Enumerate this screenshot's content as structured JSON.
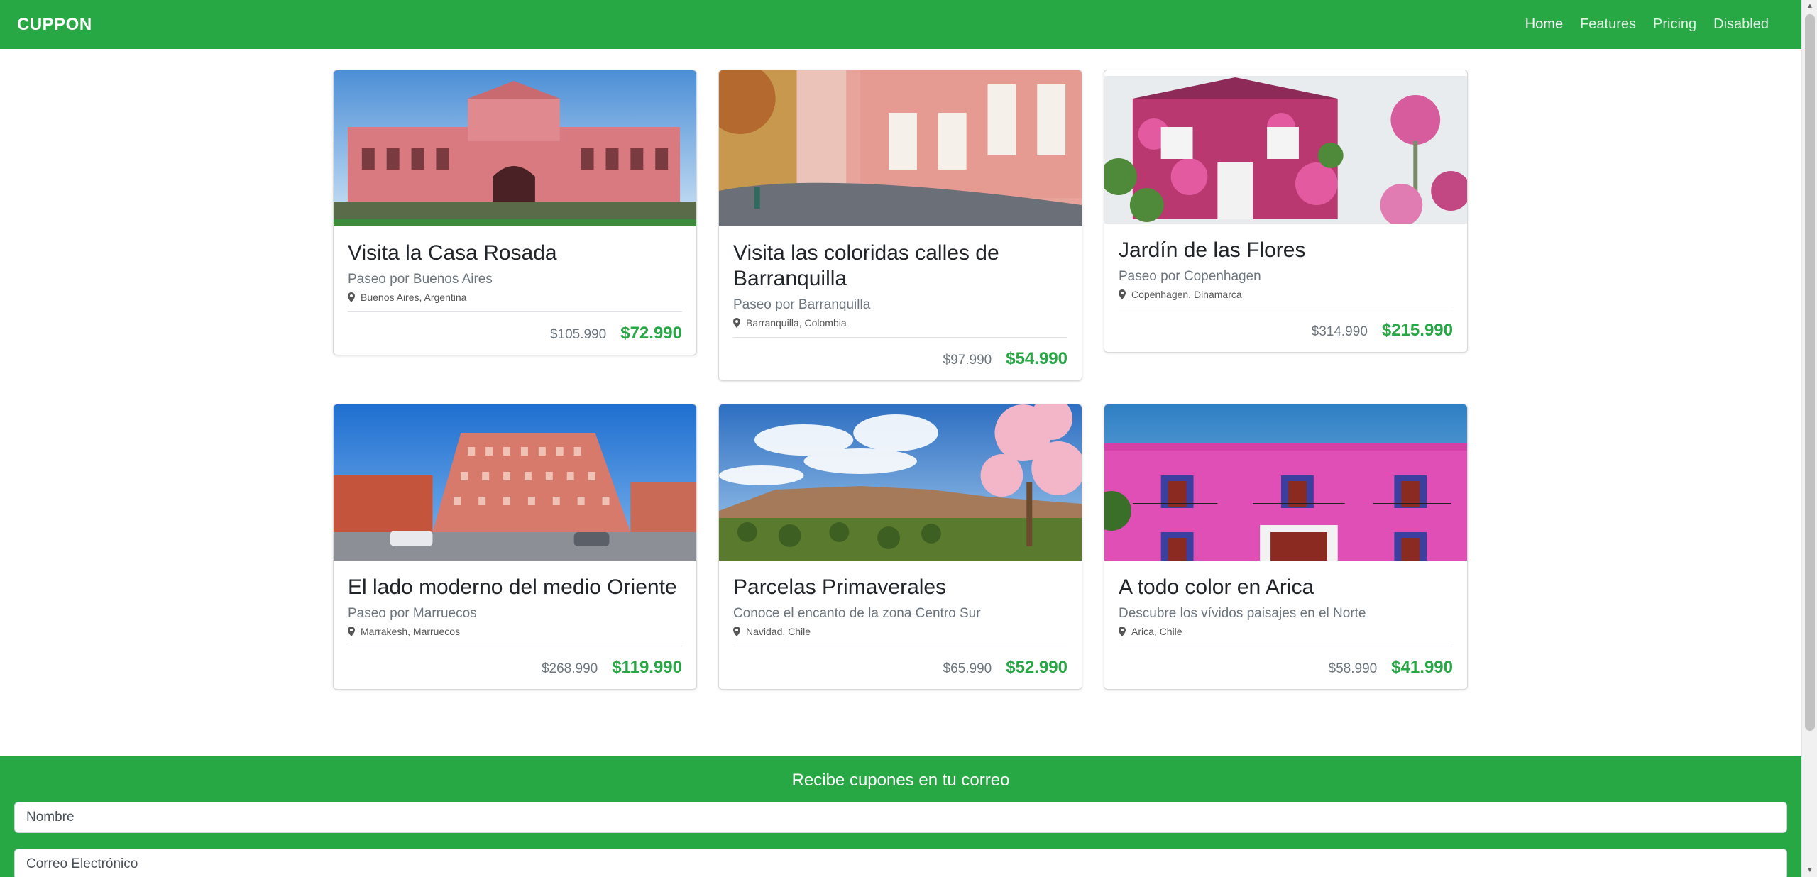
{
  "nav": {
    "brand": "CUPPON",
    "links": [
      "Home",
      "Features",
      "Pricing",
      "Disabled"
    ]
  },
  "cards": [
    {
      "title": "Visita la Casa Rosada",
      "subtitle": "Paseo por Buenos Aires",
      "location": "Buenos Aires, Argentina",
      "old_price": "$105.990",
      "price": "$72.990"
    },
    {
      "title": "Visita las coloridas calles de Barranquilla",
      "subtitle": "Paseo por Barranquilla",
      "location": "Barranquilla, Colombia",
      "old_price": "$97.990",
      "price": "$54.990"
    },
    {
      "title": "Jardín de las Flores",
      "subtitle": "Paseo por Copenhagen",
      "location": "Copenhagen, Dinamarca",
      "old_price": "$314.990",
      "price": "$215.990"
    },
    {
      "title": "El lado moderno del medio Oriente",
      "subtitle": "Paseo por Marruecos",
      "location": "Marrakesh, Marruecos",
      "old_price": "$268.990",
      "price": "$119.990"
    },
    {
      "title": "Parcelas Primaverales",
      "subtitle": "Conoce el encanto de la zona Centro Sur",
      "location": "Navidad, Chile",
      "old_price": "$65.990",
      "price": "$52.990"
    },
    {
      "title": "A todo color en Arica",
      "subtitle": "Descubre los vívidos paisajes en el Norte",
      "location": "Arica, Chile",
      "old_price": "$58.990",
      "price": "$41.990"
    }
  ],
  "subscribe": {
    "title": "Recibe cupones en tu correo",
    "name_placeholder": "Nombre",
    "email_placeholder": "Correo Electrónico"
  },
  "colors": {
    "brand": "#28a745",
    "muted": "#6c757d"
  }
}
